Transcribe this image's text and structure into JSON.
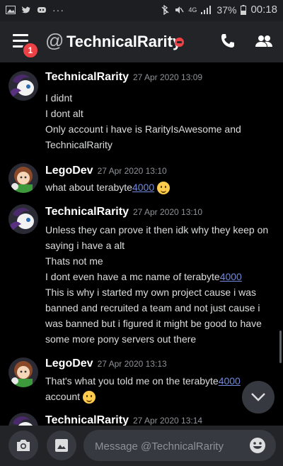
{
  "status_bar": {
    "network": "4G",
    "battery": "37%",
    "time": "00:18"
  },
  "header": {
    "at_symbol": "@",
    "channel_name": "TechnicalRarity",
    "notification_count": "1"
  },
  "messages": [
    {
      "author": "TechnicalRarity",
      "timestamp": "27 Apr 2020 13:09",
      "lines": [
        "I didnt",
        "I dont alt",
        "Only account i have is RarityIsAwesome and",
        "TechnicalRarity"
      ]
    },
    {
      "author": "LegoDev",
      "timestamp": "27 Apr 2020 13:10",
      "lines": [
        "what about terabyte",
        "4000"
      ]
    },
    {
      "author": "TechnicalRarity",
      "timestamp": "27 Apr 2020 13:10",
      "lines": [
        "Unless they can prove it then idk why they keep on",
        "saying i have a alt",
        "Thats not me",
        "I dont even have a mc name of terabyte",
        "4000",
        "This is why i started my own project cause i was",
        "banned and recruited a team and not just cause i",
        "was banned but i figured it might be good to have",
        "some more pony servers out there"
      ]
    },
    {
      "author": "LegoDev",
      "timestamp": "27 Apr 2020 13:13",
      "lines": [
        "That's what you told me on the terabyte",
        "4000",
        "account"
      ]
    },
    {
      "author": "TechnicalRarity",
      "timestamp": "27 Apr 2020 13:14"
    }
  ],
  "composer": {
    "placeholder": "Message @TechnicalRarity"
  },
  "colors": {
    "background": "#000000",
    "header": "#232428",
    "link": "#7289da",
    "dnd": "#ed4245"
  },
  "icons": [
    "hamburger-icon",
    "at-icon",
    "dnd-status-icon",
    "phone-icon",
    "members-icon",
    "chevron-down-icon",
    "camera-icon",
    "image-icon",
    "emoji-icon"
  ]
}
